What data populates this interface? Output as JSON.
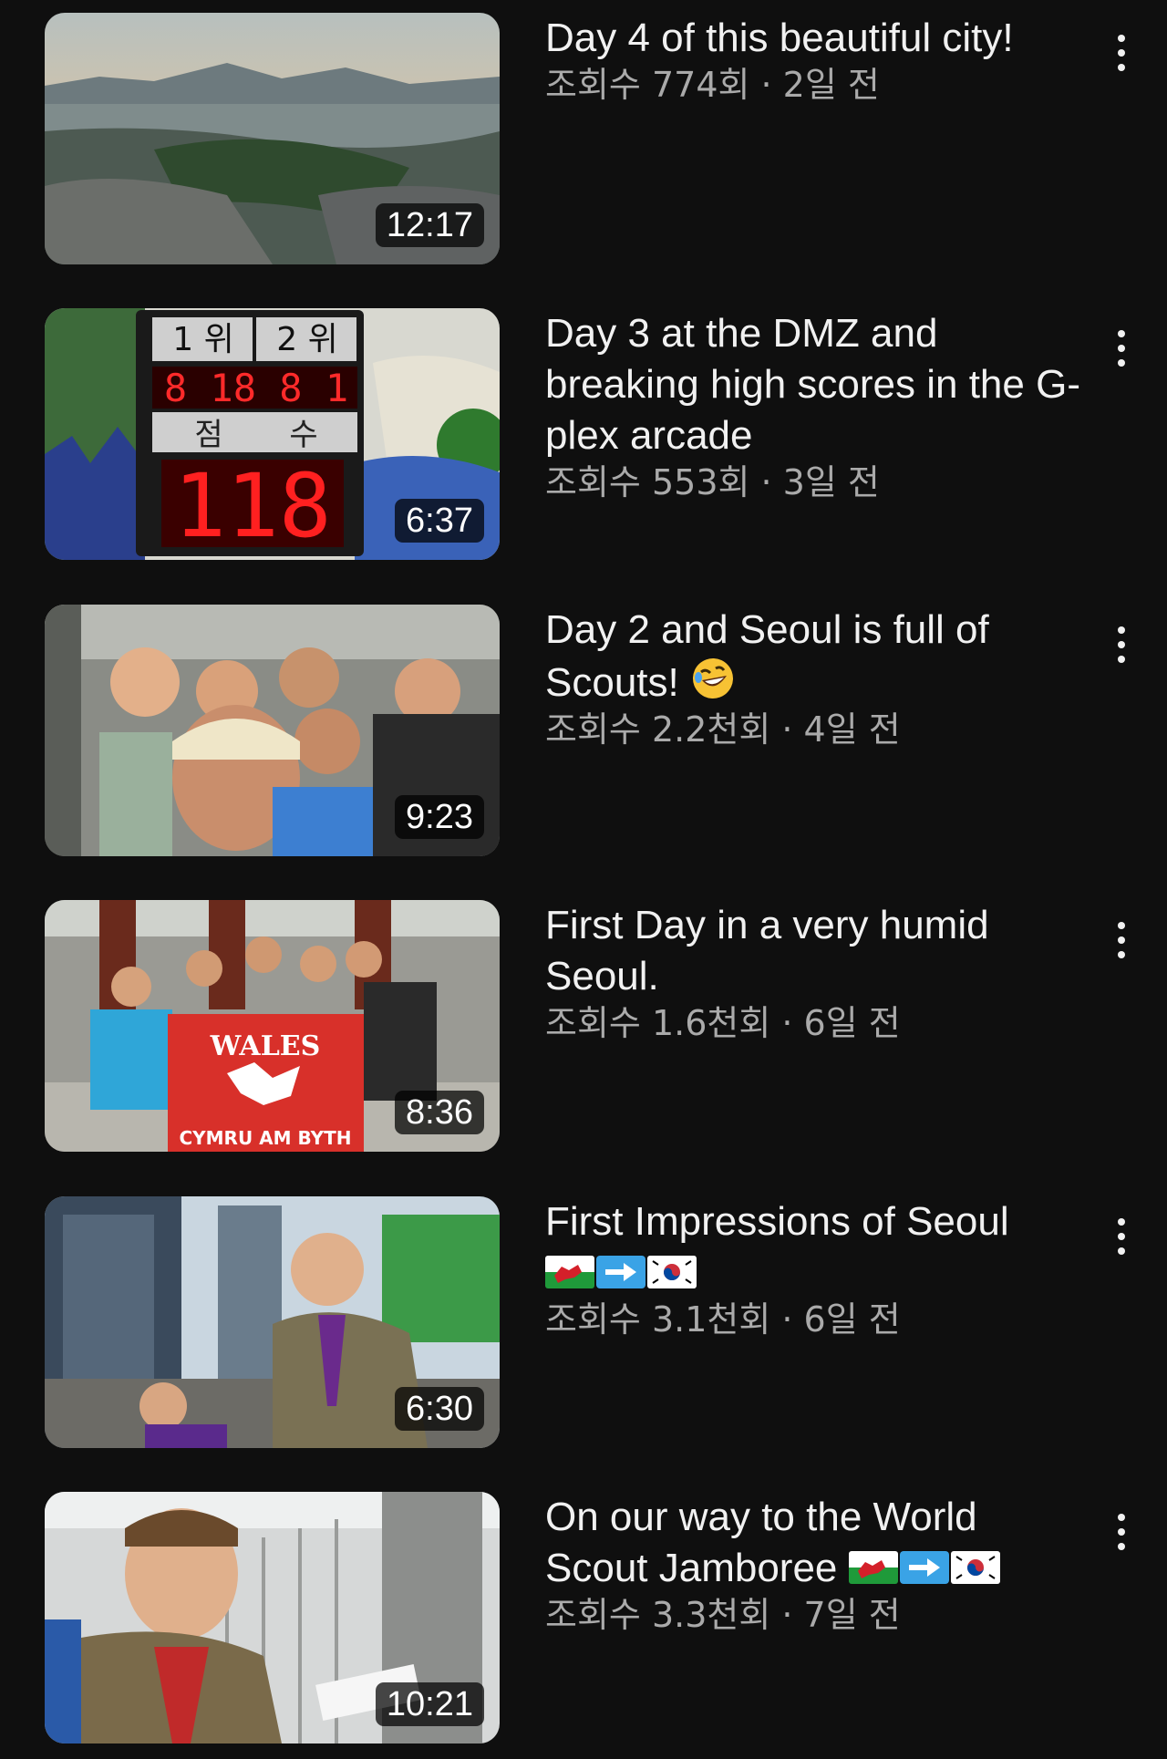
{
  "videos": [
    {
      "title": "Day 4 of this beautiful city!",
      "meta": "조회수 774회 · 2일 전",
      "duration": "12:17",
      "thumbnail": "city-skyline-aerial-view"
    },
    {
      "title": "Day 3 at the DMZ and breaking high scores in the G-plex arcade",
      "meta": "조회수 553회 · 3일 전",
      "duration": "6:37",
      "thumbnail": "arcade-scoreboard",
      "thumb_text": {
        "rank1": "1 위",
        "rank2": "2 위",
        "top_score": "8 18 8 1",
        "score_label_1": "점",
        "score_label_2": "수",
        "score": "118"
      }
    },
    {
      "title": "Day 2 and Seoul is full of Scouts!",
      "title_emoji": "rolling-on-the-floor-laughing",
      "meta": "조회수 2.2천회 · 4일 전",
      "duration": "9:23",
      "thumbnail": "group-selfie-subway"
    },
    {
      "title": "First Day in a very humid Seoul.",
      "meta": "조회수 1.6천회 · 6일 전",
      "duration": "8:36",
      "thumbnail": "group-with-wales-banner",
      "thumb_text": {
        "banner_top": "WALES",
        "banner_bottom": "CYMRU AM BYTH"
      }
    },
    {
      "title": "First Impressions of Seoul",
      "title_flags": [
        "wales-flag",
        "right-arrow",
        "south-korea-flag"
      ],
      "meta": "조회수 3.1천회 · 6일 전",
      "duration": "6:30",
      "thumbnail": "street-selfie-buildings"
    },
    {
      "title": "On our way to the World Scout Jamboree",
      "title_flags": [
        "wales-flag",
        "right-arrow",
        "south-korea-flag"
      ],
      "meta": "조회수 3.3천회 · 7일 전",
      "duration": "10:21",
      "thumbnail": "airport-selfie-ticket"
    }
  ],
  "colors": {
    "background": "#0f0f0f",
    "title": "#f1f1f1",
    "meta": "#aaaaaa",
    "duration_bg": "#000000"
  }
}
